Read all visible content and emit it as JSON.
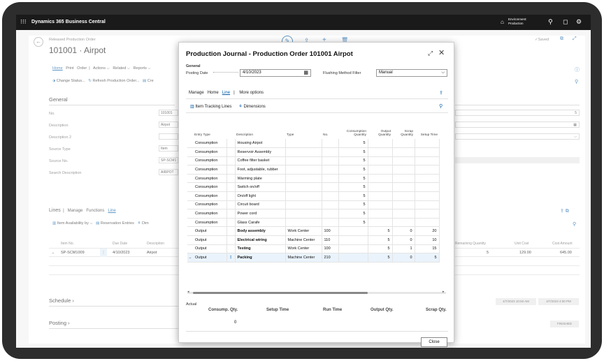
{
  "app": {
    "title": "Dynamics 365 Business Central",
    "environment_line1": "Environment:",
    "environment_line2": "Production"
  },
  "page": {
    "caption": "Released Production Order",
    "title": "101001 · Airpot",
    "saved": "✓Saved",
    "menu": [
      "Home",
      "Print",
      "Order",
      "Actions ⌵",
      "Related ⌵",
      "Reports ⌵"
    ],
    "actions": [
      "Change Status...",
      "Refresh Production Order...",
      "Cre"
    ],
    "general_header": "General",
    "general_fields": [
      {
        "label": "No.",
        "value": "101001"
      },
      {
        "label": "Description",
        "value": "Airpot"
      },
      {
        "label": "Description 2",
        "value": ""
      },
      {
        "label": "Source Type",
        "value": "Item"
      },
      {
        "label": "Source No.",
        "value": "SP-SCM1"
      },
      {
        "label": "Search Description",
        "value": "AIRPOT"
      }
    ],
    "right_value": "5",
    "lines_tabs": [
      "Lines",
      "Manage",
      "Functions",
      "Line"
    ],
    "lines_actions": [
      "Item Availability by ⌵",
      "Reservation Entries",
      "Dim"
    ],
    "lines_headers": [
      "Item No.",
      "Due Date",
      "Description"
    ],
    "lines_row": {
      "item": "SP-SCM1009",
      "due": "4/10/2023",
      "desc": "Airpot"
    },
    "lines_right_headers": [
      "Remaining Quantity",
      "Unit Cost",
      "Cost Amount"
    ],
    "lines_right_row": [
      "5",
      "129.00",
      "645.00"
    ],
    "schedule": "Schedule",
    "schedule_values": [
      "4/7/2023 10:50 AM",
      "4/7/2023 4:00 PM"
    ],
    "posting": "Posting",
    "posting_value": "FINISHED"
  },
  "dialog": {
    "title": "Production Journal - Production Order 101001 Airpot",
    "general": "General",
    "posting_date_label": "Posting Date",
    "posting_date": "4/10/2023",
    "flushing_label": "Flushing Method Filter",
    "flushing_value": "Manual",
    "tabs": [
      "Manage",
      "Home",
      "Line",
      "More options"
    ],
    "line_actions": [
      "Item Tracking Lines",
      "Dimensions"
    ],
    "columns": [
      "Entry Type",
      "Description",
      "Type",
      "No.",
      "Consumption Quantity",
      "Output Quantity",
      "Scrap Quantity",
      "Setup Time"
    ],
    "rows": [
      {
        "entry": "Consumption",
        "desc": "Housing Airpot",
        "type": "",
        "no": "",
        "cons": "5",
        "out": "",
        "scrap": "",
        "setup": ""
      },
      {
        "entry": "Consumption",
        "desc": "Reservoir Assembly",
        "type": "",
        "no": "",
        "cons": "5",
        "out": "",
        "scrap": "",
        "setup": ""
      },
      {
        "entry": "Consumption",
        "desc": "Coffee filter basket",
        "type": "",
        "no": "",
        "cons": "5",
        "out": "",
        "scrap": "",
        "setup": ""
      },
      {
        "entry": "Consumption",
        "desc": "Foot, adjustable, rubber",
        "type": "",
        "no": "",
        "cons": "5",
        "out": "",
        "scrap": "",
        "setup": ""
      },
      {
        "entry": "Consumption",
        "desc": "Warming plate",
        "type": "",
        "no": "",
        "cons": "5",
        "out": "",
        "scrap": "",
        "setup": ""
      },
      {
        "entry": "Consumption",
        "desc": "Switch on/off",
        "type": "",
        "no": "",
        "cons": "5",
        "out": "",
        "scrap": "",
        "setup": ""
      },
      {
        "entry": "Consumption",
        "desc": "On/off light",
        "type": "",
        "no": "",
        "cons": "5",
        "out": "",
        "scrap": "",
        "setup": ""
      },
      {
        "entry": "Consumption",
        "desc": "Circuit board",
        "type": "",
        "no": "",
        "cons": "5",
        "out": "",
        "scrap": "",
        "setup": ""
      },
      {
        "entry": "Consumption",
        "desc": "Power cord",
        "type": "",
        "no": "",
        "cons": "5",
        "out": "",
        "scrap": "",
        "setup": ""
      },
      {
        "entry": "Consumption",
        "desc": "Glass Carafe",
        "type": "",
        "no": "",
        "cons": "5",
        "out": "",
        "scrap": "",
        "setup": ""
      },
      {
        "entry": "Output",
        "desc": "Body assembly",
        "type": "Work Center",
        "no": "100",
        "cons": "",
        "out": "5",
        "scrap": "0",
        "setup": "20"
      },
      {
        "entry": "Output",
        "desc": "Electrical wiring",
        "type": "Machine Center",
        "no": "110",
        "cons": "",
        "out": "5",
        "scrap": "0",
        "setup": "10"
      },
      {
        "entry": "Output",
        "desc": "Testing",
        "type": "Work Center",
        "no": "100",
        "cons": "",
        "out": "5",
        "scrap": "1",
        "setup": "15"
      },
      {
        "entry": "Output",
        "desc": "Packing",
        "type": "Machine Center",
        "no": "210",
        "cons": "",
        "out": "5",
        "scrap": "0",
        "setup": "5"
      }
    ],
    "actual": "Actual",
    "actual_headers": [
      "Consump. Qty.",
      "Setup Time",
      "Run Time",
      "Output Qty.",
      "Scrap Qty."
    ],
    "actual_consump": "0",
    "close_label": "Close"
  }
}
